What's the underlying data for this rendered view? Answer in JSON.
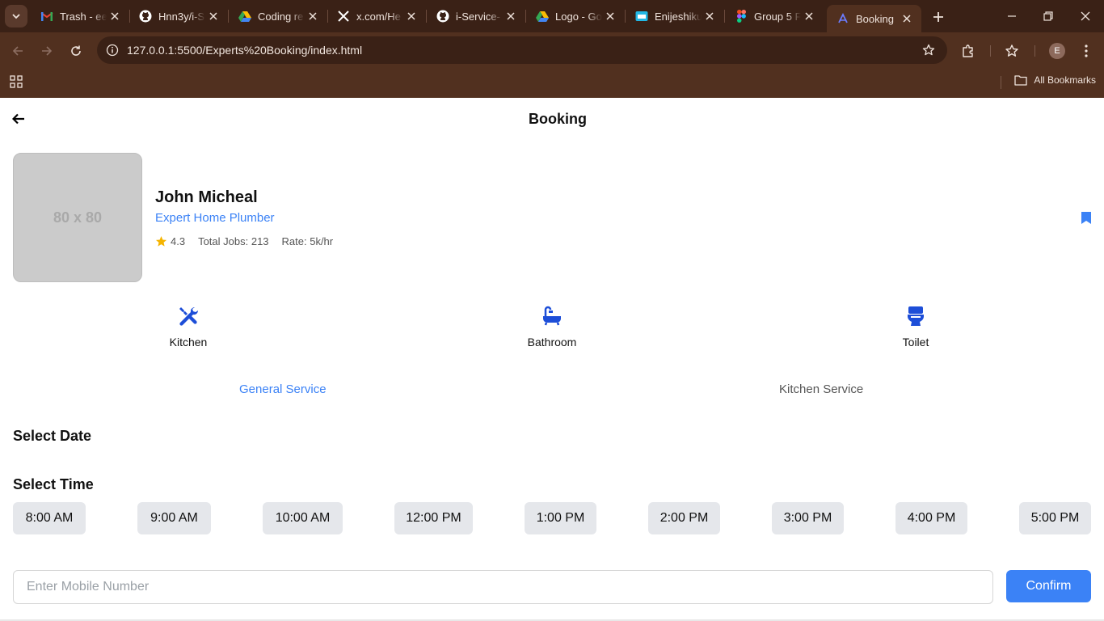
{
  "browser": {
    "tabs": [
      {
        "label": "Trash - ee",
        "icon": "gmail-icon"
      },
      {
        "label": "Hnn3y/i-S",
        "icon": "github-icon"
      },
      {
        "label": "Coding re",
        "icon": "google-drive-icon"
      },
      {
        "label": "x.com/He",
        "icon": "x-icon"
      },
      {
        "label": "i-Service-",
        "icon": "github-icon"
      },
      {
        "label": "Logo - Go",
        "icon": "google-drive-icon"
      },
      {
        "label": "Enijeshiku",
        "icon": "calendar-icon"
      },
      {
        "label": "Group 5 F",
        "icon": "figma-icon"
      },
      {
        "label": "Booking",
        "icon": "booking-icon",
        "active": true
      }
    ],
    "url": "127.0.0.1:5500/Experts%20Booking/index.html",
    "profile_initial": "E",
    "all_bookmarks_label": "All Bookmarks"
  },
  "page": {
    "title": "Booking",
    "avatar_placeholder": "80 x 80",
    "expert": {
      "name": "John Micheal",
      "role": "Expert Home Plumber",
      "rating": "4.3",
      "total_jobs": "Total Jobs: 213",
      "rate": "Rate: 5k/hr"
    },
    "categories": [
      {
        "label": "Kitchen",
        "icon": "tools-icon"
      },
      {
        "label": "Bathroom",
        "icon": "bathtub-icon"
      },
      {
        "label": "Toilet",
        "icon": "toilet-icon"
      }
    ],
    "service_tabs": [
      {
        "label": "General Service",
        "active": true
      },
      {
        "label": "Kitchen Service",
        "active": false
      }
    ],
    "select_date_label": "Select Date",
    "select_time_label": "Select Time",
    "time_slots": [
      "8:00 AM",
      "9:00 AM",
      "10:00 AM",
      "12:00 PM",
      "1:00 PM",
      "2:00 PM",
      "3:00 PM",
      "4:00 PM",
      "5:00 PM"
    ],
    "mobile_placeholder": "Enter Mobile Number",
    "confirm_label": "Confirm"
  },
  "colors": {
    "accent": "#3b82f6",
    "icon_blue": "#1d4ed8",
    "chrome_dark": "#3a2116",
    "chrome_mid": "#51301f",
    "slot_bg": "#e5e7eb"
  }
}
